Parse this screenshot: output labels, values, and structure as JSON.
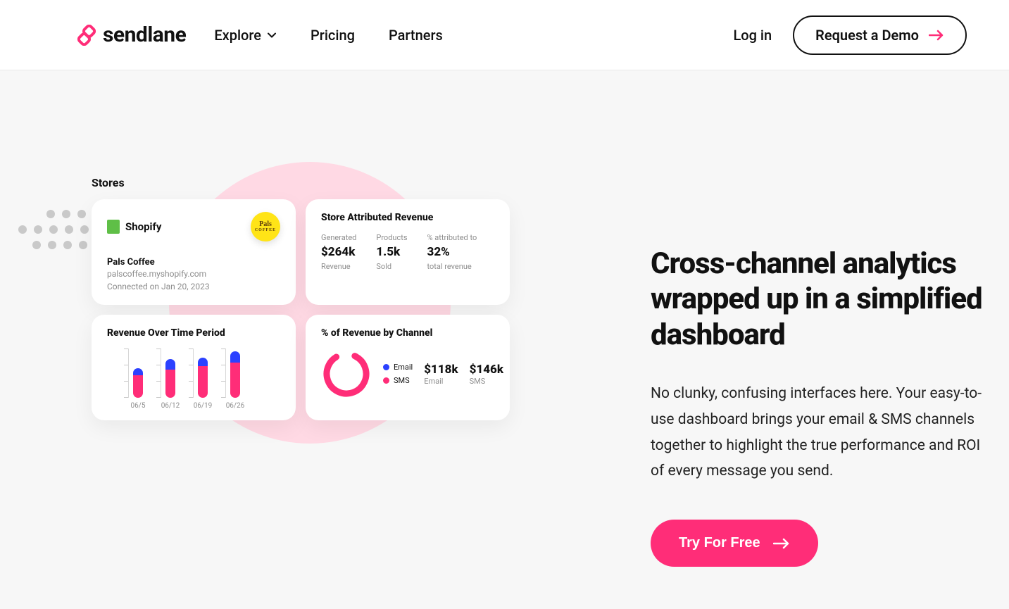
{
  "brand": {
    "name": "sendlane"
  },
  "nav": {
    "explore": "Explore",
    "pricing": "Pricing",
    "partners": "Partners",
    "login": "Log in",
    "demoCta": "Request a Demo"
  },
  "hero": {
    "headline": "Cross-channel analytics wrapped up in a simplified dashboard",
    "body": "No clunky, confusing interfaces here. Your easy-to-use dashboard brings your email & SMS channels together to highlight the true performance and ROI of every message you send.",
    "cta": "Try For Free"
  },
  "dashboard": {
    "storesTitle": "Stores",
    "shopify": {
      "provider": "Shopify",
      "badgeTop": "Pals",
      "badgeBottom": "COFFEE",
      "storeName": "Pals Coffee",
      "domain": "palscoffee.myshopify.com",
      "connected": "Connected on Jan 20, 2023"
    },
    "attributed": {
      "title": "Store Attributed Revenue",
      "metrics": [
        {
          "lbl": "Generated",
          "val": "$264k",
          "sub": "Revenue"
        },
        {
          "lbl": "Products",
          "val": "1.5k",
          "sub": "Sold"
        },
        {
          "lbl": "% attributed to",
          "val": "32%",
          "sub": "total revenue"
        }
      ]
    },
    "revenueTime": {
      "title": "Revenue Over Time Period"
    },
    "revenueChannel": {
      "title": "% of Revenue by Channel",
      "legend": {
        "email": "Email",
        "sms": "SMS"
      },
      "email": {
        "val": "$118k",
        "sub": "Email"
      },
      "sms": {
        "val": "$146k",
        "sub": "SMS"
      }
    }
  },
  "chart_data": [
    {
      "type": "bar",
      "title": "Revenue Over Time Period",
      "categories": [
        "06/5",
        "06/12",
        "06/19",
        "06/26"
      ],
      "series": [
        {
          "name": "Email",
          "values": [
            10,
            15,
            12,
            16
          ]
        },
        {
          "name": "SMS",
          "values": [
            32,
            40,
            45,
            50
          ]
        }
      ],
      "ylim": [
        0,
        70
      ]
    },
    {
      "type": "pie",
      "title": "% of Revenue by Channel",
      "categories": [
        "Email",
        "SMS"
      ],
      "values": [
        118,
        146
      ]
    }
  ]
}
